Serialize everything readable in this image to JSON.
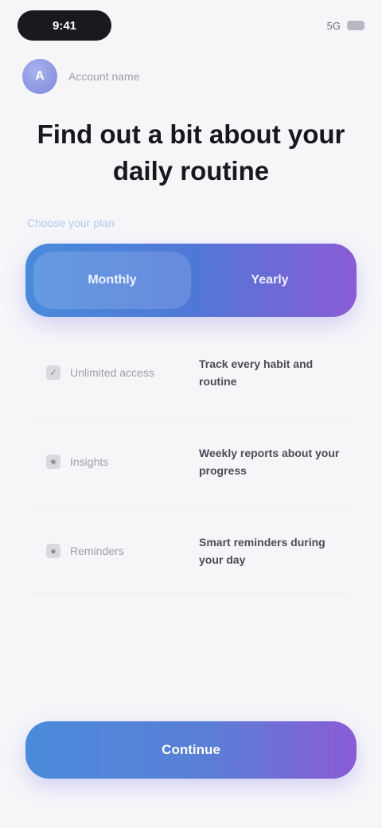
{
  "status_bar": {
    "time": "9:41",
    "right_text": "5G"
  },
  "profile": {
    "initials": "A",
    "name": "Account name"
  },
  "headline": "Find out a bit about your daily routine",
  "section_label": "Choose your plan",
  "plan_options": [
    {
      "label": "Monthly"
    },
    {
      "label": "Yearly"
    }
  ],
  "features": [
    {
      "icon": "check-icon",
      "glyph": "✓",
      "name": "Unlimited access",
      "desc": "Track every habit and routine"
    },
    {
      "icon": "star-icon",
      "glyph": "★",
      "name": "Insights",
      "desc": "Weekly reports about your progress"
    },
    {
      "icon": "bell-icon",
      "glyph": "●",
      "name": "Reminders",
      "desc": "Smart reminders during your day"
    }
  ],
  "cta_label": "Continue",
  "colors": {
    "gradient_start": "#4a8bdb",
    "gradient_end": "#8a5cd5",
    "background": "#f6f6f9"
  }
}
